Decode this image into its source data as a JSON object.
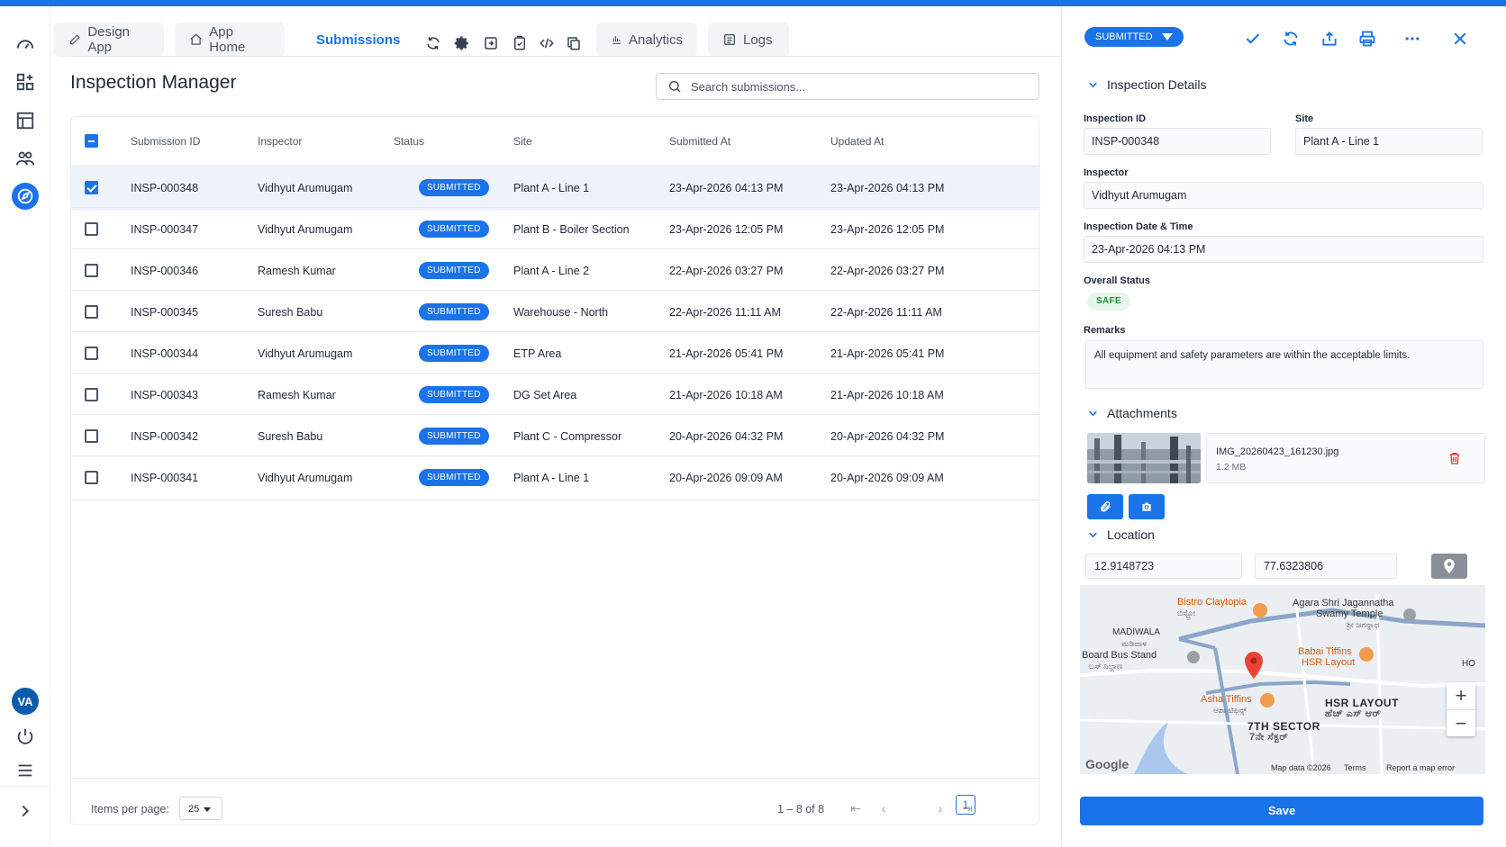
{
  "tabs": {
    "design_app": "Design App",
    "app_home": "App Home",
    "submissions": "Submissions",
    "analytics": "Analytics",
    "logs": "Logs"
  },
  "page": {
    "title": "Inspection Manager",
    "search_placeholder": "Search submissions..."
  },
  "table": {
    "columns": [
      "Submission ID",
      "Inspector",
      "Status",
      "Site",
      "Submitted At",
      "Updated At"
    ],
    "rows": [
      {
        "id": "INSP-000348",
        "inspector": "Vidhyut Arumugam",
        "status": "SUBMITTED",
        "site": "Plant A - Line 1",
        "submitted": "23-Apr-2026 04:13 PM",
        "updated": "23-Apr-2026 04:13 PM",
        "selected": true
      },
      {
        "id": "INSP-000347",
        "inspector": "Vidhyut Arumugam",
        "status": "SUBMITTED",
        "site": "Plant B - Boiler Section",
        "submitted": "23-Apr-2026 12:05 PM",
        "updated": "23-Apr-2026 12:05 PM",
        "selected": false
      },
      {
        "id": "INSP-000346",
        "inspector": "Ramesh Kumar",
        "status": "SUBMITTED",
        "site": "Plant A - Line 2",
        "submitted": "22-Apr-2026 03:27 PM",
        "updated": "22-Apr-2026 03:27 PM",
        "selected": false
      },
      {
        "id": "INSP-000345",
        "inspector": "Suresh Babu",
        "status": "SUBMITTED",
        "site": "Warehouse - North",
        "submitted": "22-Apr-2026 11:11 AM",
        "updated": "22-Apr-2026 11:11 AM",
        "selected": false
      },
      {
        "id": "INSP-000344",
        "inspector": "Vidhyut Arumugam",
        "status": "SUBMITTED",
        "site": "ETP Area",
        "submitted": "21-Apr-2026 05:41 PM",
        "updated": "21-Apr-2026 05:41 PM",
        "selected": false
      },
      {
        "id": "INSP-000343",
        "inspector": "Ramesh Kumar",
        "status": "SUBMITTED",
        "site": "DG Set Area",
        "submitted": "21-Apr-2026 10:18 AM",
        "updated": "21-Apr-2026 10:18 AM",
        "selected": false
      },
      {
        "id": "INSP-000342",
        "inspector": "Suresh Babu",
        "status": "SUBMITTED",
        "site": "Plant C - Compressor",
        "submitted": "20-Apr-2026 04:32 PM",
        "updated": "20-Apr-2026 04:32 PM",
        "selected": false
      },
      {
        "id": "INSP-000341",
        "inspector": "Vidhyut Arumugam",
        "status": "SUBMITTED",
        "site": "Plant A - Line 1",
        "submitted": "20-Apr-2026 09:09 AM",
        "updated": "20-Apr-2026 09:09 AM",
        "selected": false
      }
    ]
  },
  "pagination": {
    "items_per_page_label": "Items per page:",
    "items_per_page": "25",
    "range": "1 – 8 of 8",
    "current_page": "1"
  },
  "panel": {
    "status": "SUBMITTED",
    "details_title": "Inspection Details",
    "inspection_id_label": "Inspection ID",
    "inspection_id": "INSP-000348",
    "site_label": "Site",
    "site": "Plant A - Line 1",
    "inspector_label": "Inspector",
    "inspector": "Vidhyut Arumugam",
    "datetime_label": "Inspection Date & Time",
    "datetime": "23-Apr-2026 04:13 PM",
    "overall_status_label": "Overall Status",
    "overall_status": "SAFE",
    "remarks_label": "Remarks",
    "remarks": "All equipment and safety parameters are within the acceptable limits.",
    "attachments_title": "Attachments",
    "attachment_name": "IMG_20260423_161230.jpg",
    "attachment_size": "1.2 MB",
    "location_title": "Location",
    "latitude": "12.9148723",
    "longitude": "77.6323806",
    "save_label": "Save"
  },
  "map": {
    "labels": {
      "bistro": "Bistro Claytopia",
      "bistro_sub": "ಬಿಸ್ಟ್ರೋ",
      "agara": "Agara Shri Jagannatha",
      "agara2": "Swamy Temple",
      "agara_sub": "ಶ್ರೀ ಜಗನ್ನಾಥ",
      "madiwala": "MADIWALA",
      "madiwala_sub": "ಮಡಿವಾಳ",
      "board": "Board Bus Stand",
      "board_sub": "ಬಸ್ ನಿಲ್ದಾಣ",
      "babai": "Babai Tiffins",
      "babai2": "HSR Layout",
      "ho": "HO",
      "asha": "Asha Tiffins",
      "asha_sub": "ಆಶಾ ಟಿಫಿನ್ಸ್",
      "hsr": "HSR LAYOUT",
      "hsr_sub": "ಹೆಚ್ ಎಸ್ ಆರ್",
      "sector": "7TH SECTOR",
      "sector_sub": "7ನೇ ಸೆಕ್ಟರ್",
      "google": "Google",
      "mapdata": "Map data ©2026",
      "terms": "Terms",
      "report": "Report a map error"
    }
  },
  "user": {
    "initials": "VA"
  }
}
